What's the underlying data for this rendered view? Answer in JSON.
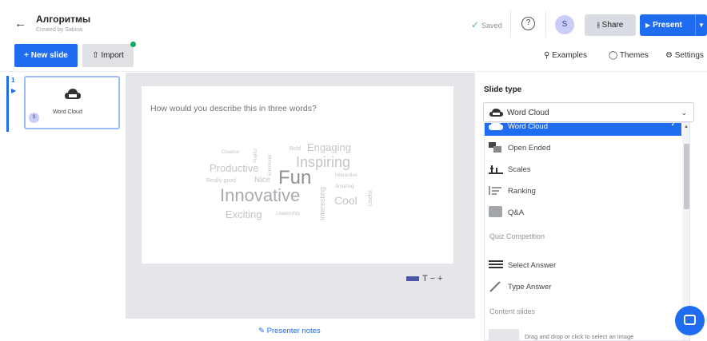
{
  "header": {
    "back_icon": "arrow-left-icon",
    "presentation_title": "Алгоритмы",
    "subtitle": "Created by Sabina",
    "saved_label": "Saved",
    "help_icon": "question-circle-icon",
    "avatar_initial": "S",
    "share_label": "Share",
    "present_label": "Present"
  },
  "toolbar": {
    "new_slide_label": "+ New slide",
    "import_label": "Import",
    "examples_label": "Examples",
    "themes_label": "Themes",
    "settings_label": "Settings"
  },
  "slide_list": {
    "slide_number": "1",
    "thumb_label": "Word Cloud",
    "thumb_avatar": "S"
  },
  "slide": {
    "question": "How would you describe this in three words?",
    "words": [
      {
        "text": "Creative"
      },
      {
        "text": "Playful"
      },
      {
        "text": "Emotional"
      },
      {
        "text": "Bold"
      },
      {
        "text": "Engaging"
      },
      {
        "text": "Productive"
      },
      {
        "text": "Inspiring"
      },
      {
        "text": "Really good"
      },
      {
        "text": "Nice"
      },
      {
        "text": "Fun"
      },
      {
        "text": "Interactive"
      },
      {
        "text": "Amazing"
      },
      {
        "text": "Innovative"
      },
      {
        "text": "Cool"
      },
      {
        "text": "Useful"
      },
      {
        "text": "Exciting"
      },
      {
        "text": "Leadership"
      },
      {
        "text": "Interesting"
      }
    ],
    "tools": "T − +",
    "presenter_notes_label": "Presenter notes"
  },
  "panel": {
    "heading": "Slide type",
    "selected_type": "Word Cloud",
    "options": [
      {
        "label": "Word Cloud",
        "icon": "word-cloud-icon",
        "selected": true
      },
      {
        "label": "Open Ended",
        "icon": "open-ended-icon",
        "selected": false
      },
      {
        "label": "Scales",
        "icon": "scales-icon",
        "selected": false
      },
      {
        "label": "Ranking",
        "icon": "ranking-icon",
        "selected": false
      },
      {
        "label": "Q&A",
        "icon": "qa-icon",
        "selected": false
      }
    ],
    "section_quiz": "Quiz Competition",
    "quiz_options": [
      {
        "label": "Select Answer",
        "icon": "select-answer-icon"
      },
      {
        "label": "Type Answer",
        "icon": "type-answer-icon"
      }
    ],
    "section_content": "Content slides",
    "dropzone_text": "Drag and drop or click to select an image"
  },
  "colors": {
    "accent": "#1f6cf0",
    "saved_check": "#5cb87a",
    "import_badge": "#14a867"
  }
}
